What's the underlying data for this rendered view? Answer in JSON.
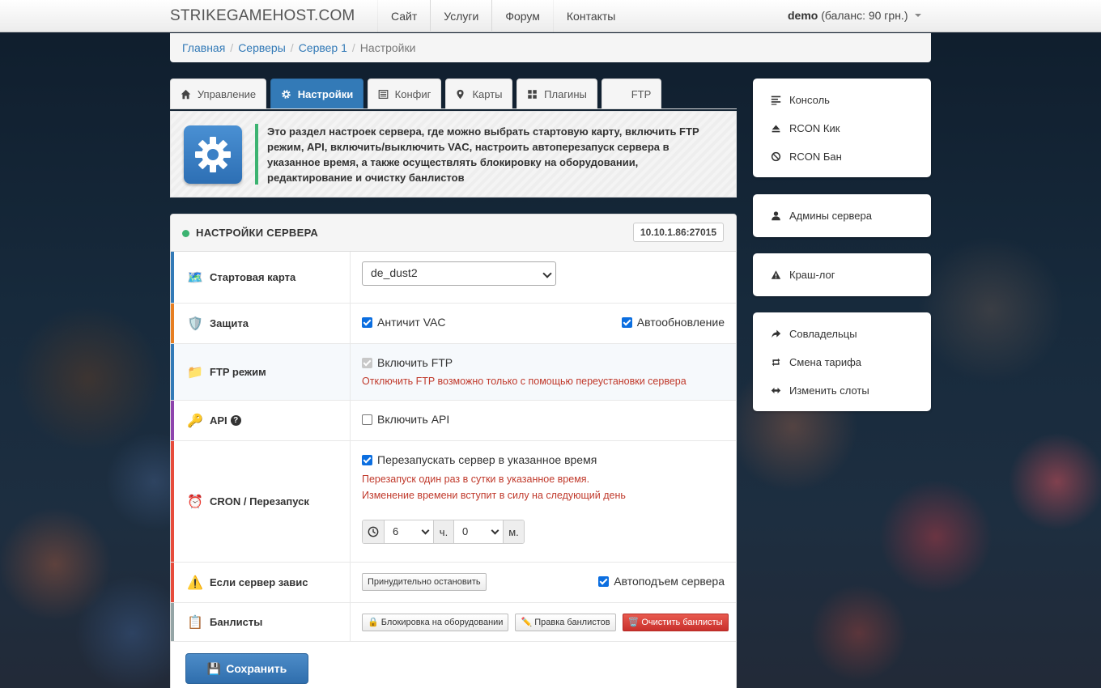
{
  "navbar": {
    "brand": "STRIKEGAMEHOST.COM",
    "links": [
      "Сайт",
      "Услуги",
      "Форум",
      "Контакты"
    ],
    "user_name": "demo",
    "user_balance": "(баланс: 90 грн.)"
  },
  "breadcrumb": {
    "items": [
      "Главная",
      "Серверы",
      "Сервер 1"
    ],
    "active": "Настройки",
    "separator": "/"
  },
  "tabs": [
    {
      "label": "Управление",
      "icon": "home-icon"
    },
    {
      "label": "Настройки",
      "icon": "gear-icon",
      "active": true
    },
    {
      "label": "Конфиг",
      "icon": "list-icon"
    },
    {
      "label": "Карты",
      "icon": "map-marker-icon"
    },
    {
      "label": "Плагины",
      "icon": "grid-icon"
    },
    {
      "label": "FTP",
      "icon": ""
    }
  ],
  "info": {
    "text": "Это раздел настроек сервера, где можно выбрать стартовую карту, включить FTP режим, API, включить/выключить VAC, настроить автоперезапуск сервера в указанное время, а также осуществлять блокировку на оборудовании, редактирование и очистку банлистов"
  },
  "panel": {
    "title": "НАСТРОЙКИ СЕРВЕРА",
    "ip": "10.10.1.86:27015",
    "rows": {
      "start_map": {
        "label": "Стартовая карта",
        "value": "de_dust2"
      },
      "protection": {
        "label": "Защита",
        "vac_label": "Античит VAC",
        "vac": true,
        "autoupdate_label": "Автообновление",
        "autoupdate": true
      },
      "ftp": {
        "label": "FTP режим",
        "enable_label": "Включить FTP",
        "enabled": true,
        "hint": "Отключить FTP возможно только с помощью переустановки сервера"
      },
      "api": {
        "label": "API",
        "help": "?",
        "enable_label": "Включить API",
        "enabled": false
      },
      "cron": {
        "label": "CRON / Перезапуск",
        "restart_label": "Перезапускать сервер в указанное время",
        "enabled": true,
        "hint1": "Перезапуск один раз в сутки в указанное время.",
        "hint2": "Изменение времени вступит в силу на следующий день",
        "hour": "6",
        "hour_unit": "ч.",
        "minute": "0",
        "minute_unit": "м."
      },
      "hang": {
        "label": "Если сервер завис",
        "force_stop": "Принудительно остановить",
        "autoraise_label": "Автоподъем сервера",
        "autoraise": true
      },
      "banlists": {
        "label": "Банлисты",
        "hw_block": "Блокировка на оборудовании",
        "edit": "Правка банлистов",
        "clear": "Очистить банлисты"
      }
    },
    "save": "Сохранить"
  },
  "sidebar": {
    "group1": [
      "Консоль",
      "RCON Кик",
      "RCON Бан"
    ],
    "group2": [
      "Админы сервера"
    ],
    "group3": [
      "Краш-лог"
    ],
    "group4": [
      "Совладельцы",
      "Смена тарифа",
      "Изменить слоты"
    ]
  },
  "colors": {
    "primary": "#337ab7",
    "success": "#3cb371",
    "danger": "#c9302c",
    "hint": "#c0392b"
  }
}
